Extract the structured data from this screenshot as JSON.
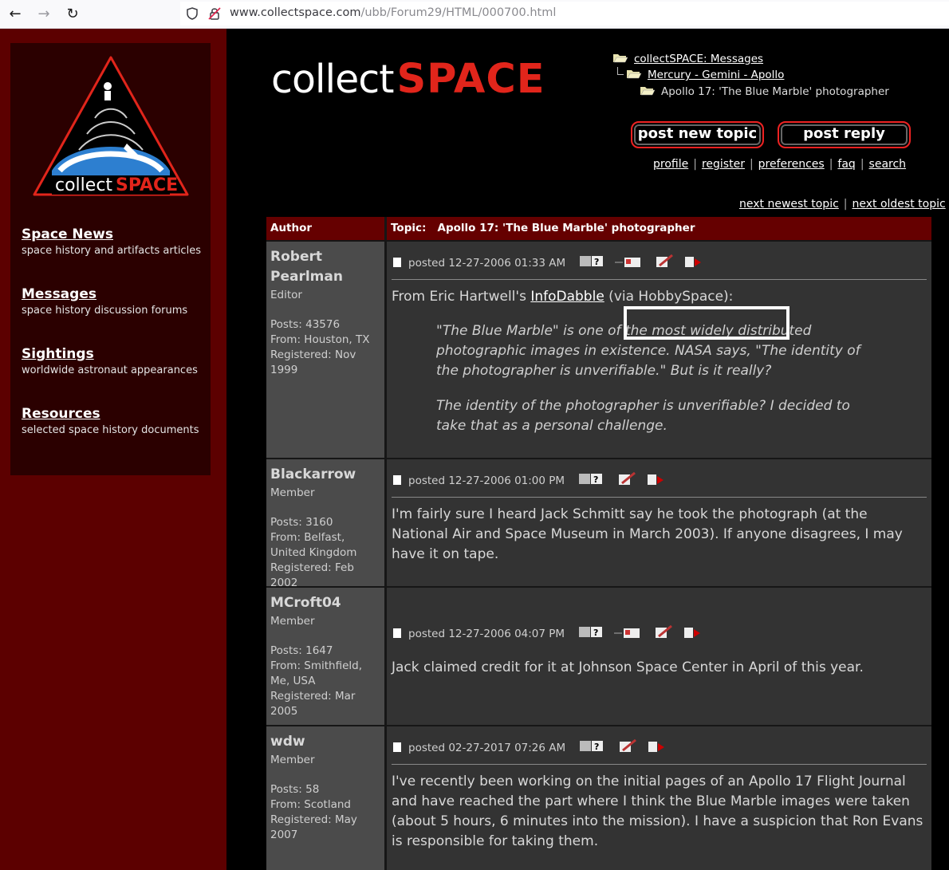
{
  "browser": {
    "url_host": "www.collectspace.com",
    "url_path": "/ubb/Forum29/HTML/000700.html"
  },
  "sidebar": {
    "logo_text_collect": "collect",
    "logo_text_space": "SPACE",
    "items": [
      {
        "title": "Space News",
        "desc": "space history and artifacts articles"
      },
      {
        "title": "Messages",
        "desc": "space history discussion forums"
      },
      {
        "title": "Sightings",
        "desc": "worldwide astronaut appearances"
      },
      {
        "title": "Resources",
        "desc": "selected space history documents"
      }
    ]
  },
  "header": {
    "brand_collect": "collect",
    "brand_space": "SPACE",
    "breadcrumb": [
      {
        "label": "collectSPACE: Messages"
      },
      {
        "label": "Mercury - Gemini - Apollo"
      },
      {
        "label": "Apollo 17: 'The Blue Marble' photographer"
      }
    ],
    "post_new_topic": "post new topic",
    "post_reply": "post reply",
    "links": [
      "profile",
      "register",
      "preferences",
      "faq",
      "search"
    ],
    "sep": "|",
    "next_newest": "next newest topic",
    "next_oldest": "next oldest topic"
  },
  "table": {
    "author_header": "Author",
    "topic_label": "Topic:",
    "topic_title": "Apollo 17: 'The Blue Marble' photographer"
  },
  "posts": [
    {
      "author": "Robert Pearlman",
      "role": "Editor",
      "posts": "Posts: 43576",
      "from": "From: Houston, TX",
      "registered": "Registered: Nov 1999",
      "posted": "posted 12-27-2006 01:33 AM",
      "text_before": "From Eric Hartwell's ",
      "link": "InfoDabble",
      "text_after": " (via HobbySpace):",
      "quote1": "\"The Blue Marble\" is one of the most widely distributed photographic images in existence. NASA says, \"The identity of the photographer is unverifiable.\" But is it really?",
      "quote2": "The identity of the photographer is unverifiable? I decided to take that as a personal challenge."
    },
    {
      "author": "Blackarrow",
      "role": "Member",
      "posts": "Posts: 3160",
      "from": "From: Belfast, United Kingdom",
      "registered": "Registered: Feb 2002",
      "posted": "posted 12-27-2006 01:00 PM",
      "text": "I'm fairly sure I heard Jack Schmitt say he took the photograph (at the National Air and Space Museum in March 2003). If anyone disagrees, I may have it on tape."
    },
    {
      "author": "MCroft04",
      "role": "Member",
      "posts": "Posts: 1647",
      "from": "From: Smithfield, Me, USA",
      "registered": "Registered: Mar 2005",
      "posted": "posted 12-27-2006 04:07 PM",
      "text": "Jack claimed credit for it at Johnson Space Center in April of this year."
    },
    {
      "author": "wdw",
      "role": "Member",
      "posts": "Posts: 58",
      "from": "From: Scotland",
      "registered": "Registered: May 2007",
      "posted": "posted 02-27-2017 07:26 AM",
      "text": "I've recently been working on the initial pages of an Apollo 17 Flight Journal and have reached the part where I think the Blue Marble images were taken (about 5 hours, 6 minutes into the mission). I have a suspicion that Ron Evans is responsible for taking them."
    }
  ],
  "colors": {
    "brand_red": "#e1251b",
    "sidebar_red": "#5c0000",
    "header_red": "#650000"
  }
}
